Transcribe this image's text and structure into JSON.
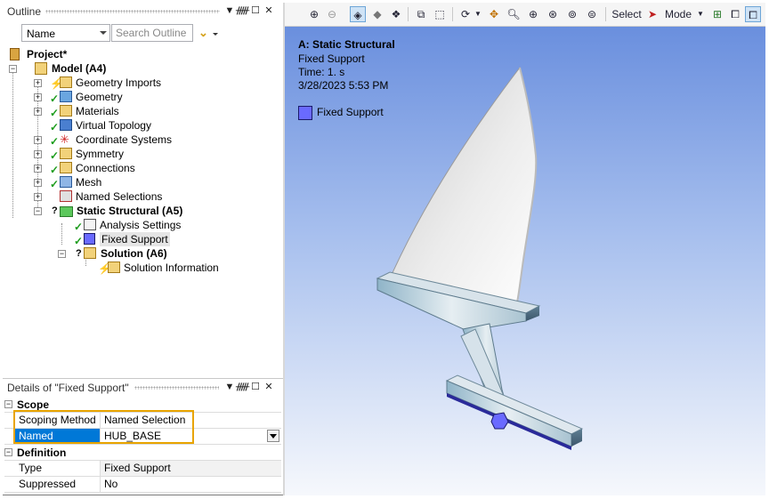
{
  "outline": {
    "title": "Outline",
    "pin_icon": "pin-icon",
    "dropdown_icon": "dropdown-icon",
    "maximize_icon": "maximize-icon",
    "close_icon": "close-icon",
    "name_filter": "Name",
    "search_placeholder": "Search Outline",
    "tree": {
      "project": "Project*",
      "model": "Model (A4)",
      "items": [
        "Geometry Imports",
        "Geometry",
        "Materials",
        "Virtual Topology",
        "Coordinate Systems",
        "Symmetry",
        "Connections",
        "Mesh",
        "Named Selections"
      ],
      "static_structural": "Static Structural (A5)",
      "analysis_settings": "Analysis Settings",
      "fixed_support": "Fixed Support",
      "solution": "Solution (A6)",
      "solution_information": "Solution Information"
    }
  },
  "details": {
    "title": "Details of \"Fixed Support\"",
    "groups": {
      "scope": "Scope",
      "definition": "Definition"
    },
    "rows": {
      "scoping_method_key": "Scoping Method",
      "scoping_method_val": "Named Selection",
      "named_selection_key": "Named Selection",
      "named_selection_val": "HUB_BASE",
      "type_key": "Type",
      "type_val": "Fixed Support",
      "suppressed_key": "Suppressed",
      "suppressed_val": "No"
    }
  },
  "toolbar": {
    "select_label": "Select",
    "mode_label": "Mode"
  },
  "viewport": {
    "title": "A: Static Structural",
    "subtitle": "Fixed Support",
    "time": "Time: 1. s",
    "date": "3/28/2023 5:53 PM",
    "legend_label": "Fixed Support",
    "legend_color": "#6a6aff"
  },
  "colors": {
    "selection_blue": "#0078d7",
    "highlight_orange": "#e8a400",
    "check_green": "#1a9c1a"
  }
}
